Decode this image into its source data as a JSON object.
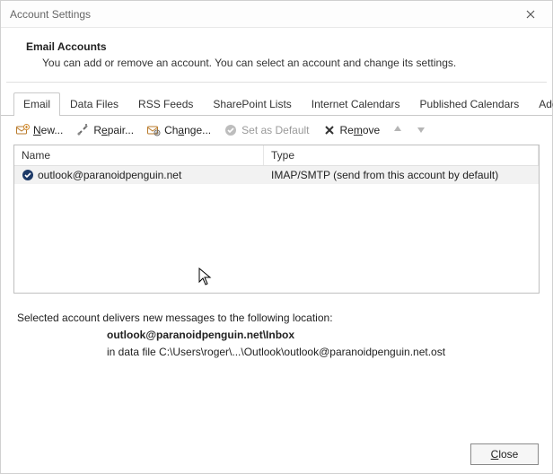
{
  "window": {
    "title": "Account Settings"
  },
  "header": {
    "heading": "Email Accounts",
    "subtext": "You can add or remove an account. You can select an account and change its settings."
  },
  "tabs": [
    {
      "label": "Email",
      "active": true
    },
    {
      "label": "Data Files",
      "active": false
    },
    {
      "label": "RSS Feeds",
      "active": false
    },
    {
      "label": "SharePoint Lists",
      "active": false
    },
    {
      "label": "Internet Calendars",
      "active": false
    },
    {
      "label": "Published Calendars",
      "active": false
    },
    {
      "label": "Address Books",
      "active": false
    }
  ],
  "toolbar": {
    "new_label": "New...",
    "repair_label": "Repair...",
    "change_label": "Change...",
    "set_default_label": "Set as Default",
    "remove_label": "Remove"
  },
  "list": {
    "columns": {
      "name": "Name",
      "type": "Type"
    },
    "rows": [
      {
        "name": "outlook@paranoidpenguin.net",
        "type": "IMAP/SMTP (send from this account by default)"
      }
    ]
  },
  "info": {
    "line1": "Selected account delivers new messages to the following location:",
    "strong": "outlook@paranoidpenguin.net\\Inbox",
    "line2": "in data file C:\\Users\\roger\\...\\Outlook\\outlook@paranoidpenguin.net.ost"
  },
  "footer": {
    "close_label": "Close"
  }
}
